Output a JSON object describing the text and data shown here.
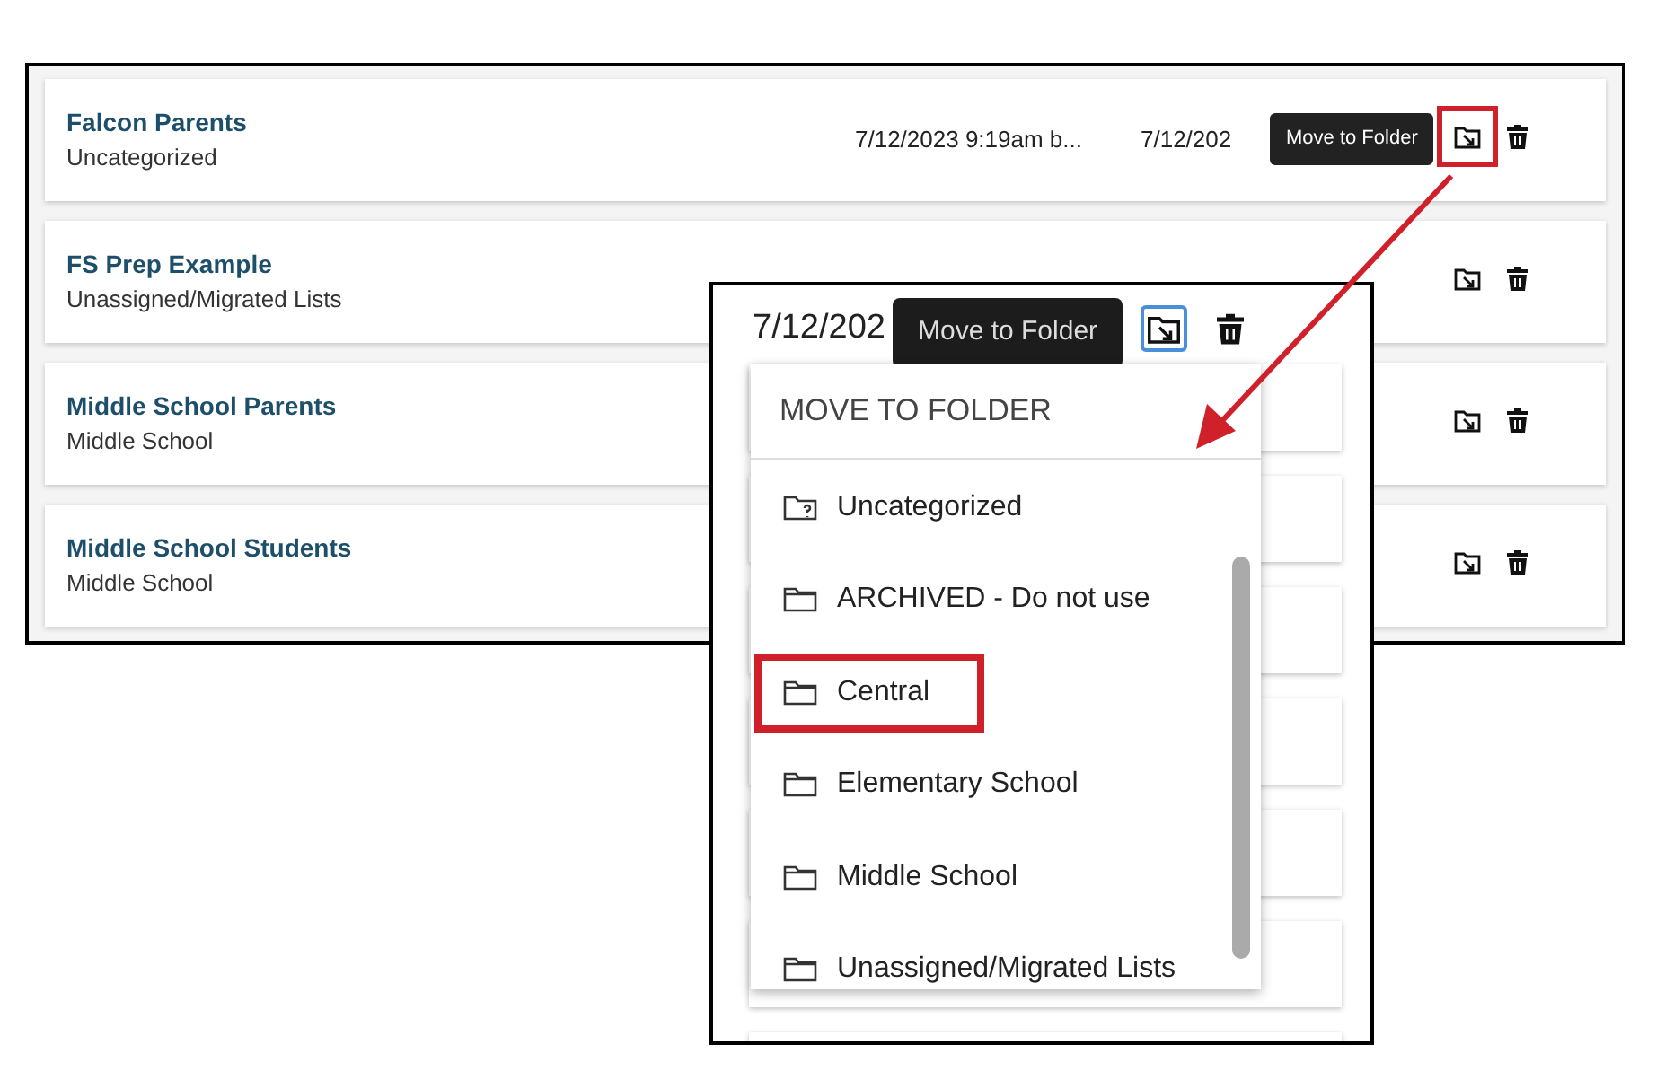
{
  "list": {
    "rows": [
      {
        "name": "Falcon Parents",
        "folder": "Uncategorized",
        "created": "7/12/2023 9:19am b...",
        "modified": "7/12/202",
        "callout": true
      },
      {
        "name": "FS Prep Example",
        "folder": "Unassigned/Migrated Lists",
        "callout": false
      },
      {
        "name": "Middle School Parents",
        "folder": "Middle School",
        "callout": false
      },
      {
        "name": "Middle School Students",
        "folder": "Middle School",
        "callout": false
      }
    ]
  },
  "tooltip": {
    "text": "Move to Folder"
  },
  "inset": {
    "date": "7/12/202",
    "tooltip": "Move to Folder",
    "menu": {
      "title": "MOVE TO FOLDER",
      "items": [
        {
          "label": "Uncategorized",
          "kind": "uncategorized",
          "callout": false
        },
        {
          "label": "ARCHIVED - Do not use",
          "kind": "folder",
          "callout": false
        },
        {
          "label": "Central",
          "kind": "folder",
          "callout": true
        },
        {
          "label": "Elementary School",
          "kind": "folder",
          "callout": false
        },
        {
          "label": "Middle School",
          "kind": "folder",
          "callout": false
        },
        {
          "label": "Unassigned/Migrated Lists",
          "kind": "folder",
          "callout": false
        }
      ]
    }
  }
}
